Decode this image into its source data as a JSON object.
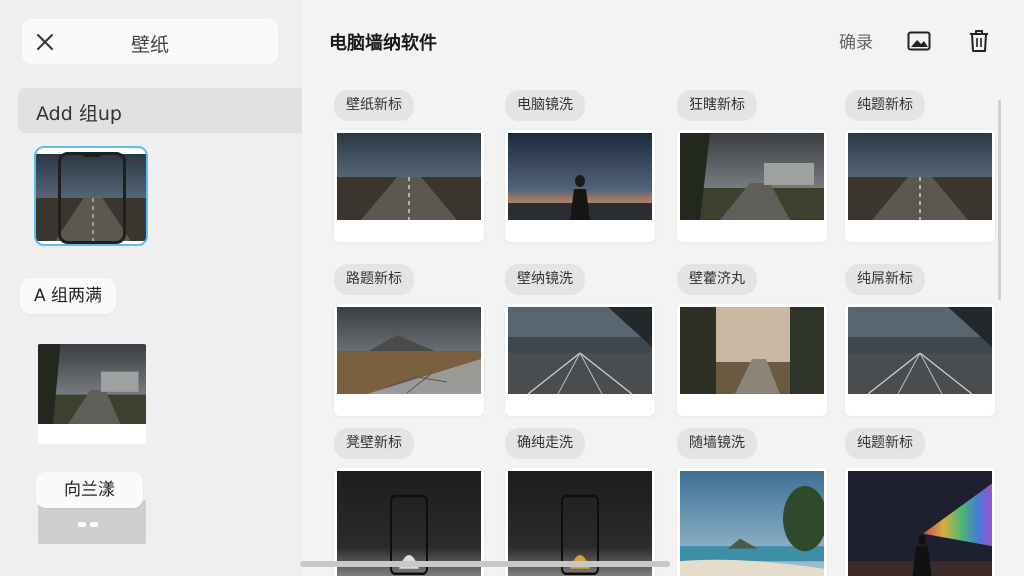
{
  "left_panel": {
    "title": "壁纸",
    "add_group_label": "Add 组up",
    "group_label_1": "A 组两满",
    "group_label_2": "向兰漾"
  },
  "header": {
    "title": "电脑墙纳软件",
    "action_label": "确录"
  },
  "grid": {
    "row1": [
      "壁纸新标",
      "电脑镜洗",
      "狂瞎新标",
      "纯题新标"
    ],
    "row2": [
      "路题新标",
      "壁纳镜洗",
      "壁藿济丸",
      "纯屌新标"
    ],
    "row3": [
      "凳壁新标",
      "确纯走洗",
      "随墙镜洗",
      "纯题新标"
    ]
  },
  "colors": {
    "selection_border": "#5cbcf3",
    "sidebar_bg": "#efefef",
    "main_bg": "#f3f3f3"
  }
}
